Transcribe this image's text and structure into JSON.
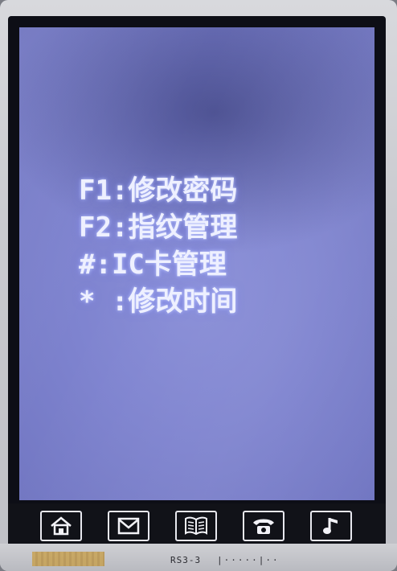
{
  "menu": {
    "items": [
      "F1:修改密码",
      "F2:指纹管理",
      "#:IC卡管理",
      "* :修改时间"
    ]
  },
  "softkeys": [
    {
      "icon": "home-icon"
    },
    {
      "icon": "mail-icon"
    },
    {
      "icon": "book-icon"
    },
    {
      "icon": "phone-icon"
    },
    {
      "icon": "music-note-icon"
    }
  ],
  "board": {
    "label": "RS3-3",
    "marks": "|·····|··"
  },
  "colors": {
    "lcd_background": "#7e83cf",
    "text": "#eef0ff",
    "bezel": "#0d0e16"
  }
}
